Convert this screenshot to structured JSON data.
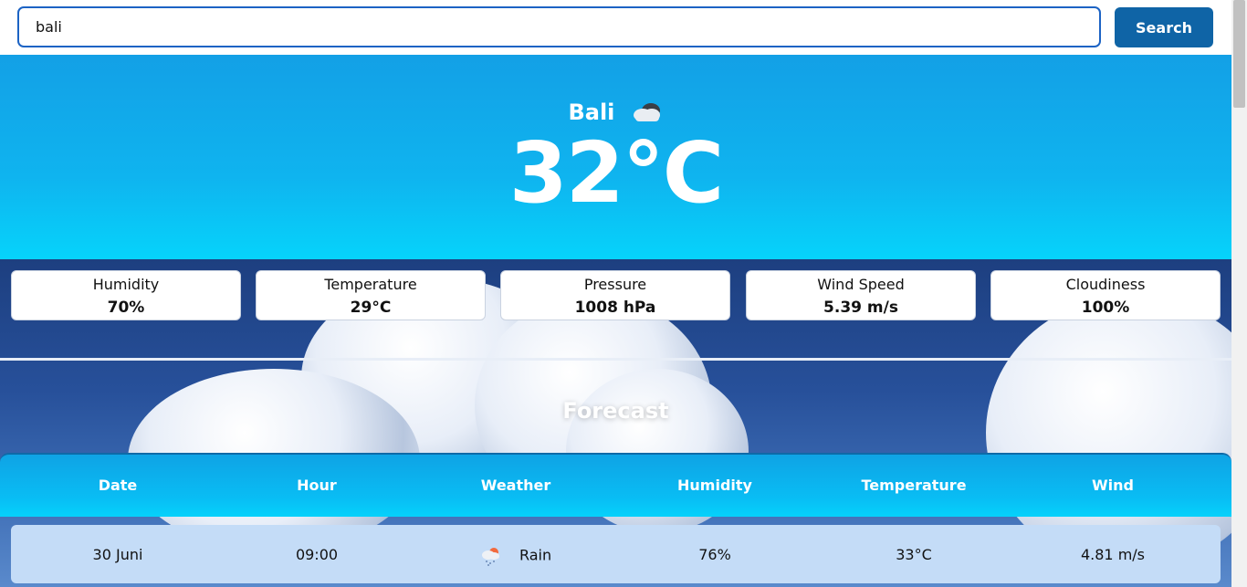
{
  "search": {
    "value": "bali",
    "button_label": "Search"
  },
  "current": {
    "city": "Bali",
    "icon": "cloud-icon",
    "temperature": "32°C"
  },
  "stats": [
    {
      "label": "Humidity",
      "value": "70%"
    },
    {
      "label": "Temperature",
      "value": "29°C"
    },
    {
      "label": "Pressure",
      "value": "1008 hPa"
    },
    {
      "label": "Wind Speed",
      "value": "5.39 m/s"
    },
    {
      "label": "Cloudiness",
      "value": "100%"
    }
  ],
  "forecast": {
    "title": "Forecast",
    "columns": [
      "Date",
      "Hour",
      "Weather",
      "Humidity",
      "Temperature",
      "Wind"
    ],
    "rows": [
      {
        "date": "30 Juni",
        "hour": "09:00",
        "weather_icon": "rain-icon",
        "weather": "Rain",
        "humidity": "76%",
        "temperature": "33°C",
        "wind": "4.81 m/s"
      }
    ]
  },
  "colors": {
    "accent": "#0f64a6",
    "hero_top": "#13a0e6",
    "hero_bottom": "#06d3fb",
    "row_bg": "#c4dcf7"
  }
}
